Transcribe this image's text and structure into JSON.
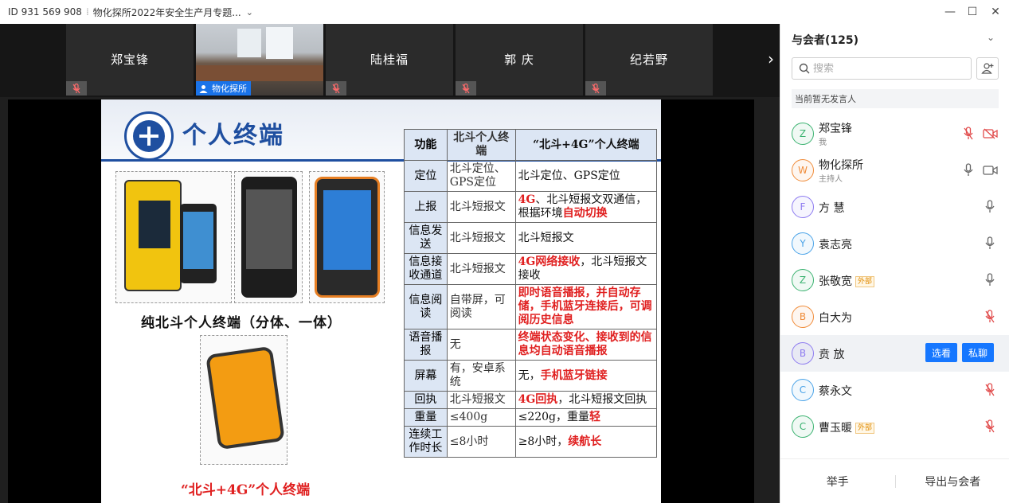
{
  "titlebar": {
    "meeting_id": "ID 931 569 908",
    "separator": "⁞",
    "meeting_title": "物化探所2022年安全生产月专题...",
    "dropdown": "⌄",
    "minimize": "—",
    "maximize": "☐",
    "close": "✕"
  },
  "strip": {
    "tiles": [
      {
        "name": "郑宝锋"
      },
      {
        "name": "物化探所"
      },
      {
        "name": "陆桂福"
      },
      {
        "name": "郭  庆"
      },
      {
        "name": "纪若野"
      }
    ],
    "next": "›"
  },
  "slide": {
    "title": "个人终端",
    "caption1": "纯北斗个人终端（分体、一体）",
    "caption2": "“北斗+4G”个人终端",
    "table": {
      "header": [
        "功能",
        "北斗个人终端",
        "“北斗+4G”个人终端"
      ],
      "rows": [
        {
          "f": "定位",
          "b": "北斗定位、GPS定位",
          "c": [
            {
              "t": "北斗定位、GPS定位"
            }
          ]
        },
        {
          "f": "上报",
          "b": "北斗短报文",
          "c": [
            {
              "t": "4G",
              "red": true
            },
            {
              "t": "、北斗短报文双通信，根据环境"
            },
            {
              "t": "自动切换",
              "red": true
            }
          ]
        },
        {
          "f": "信息发送",
          "b": "北斗短报文",
          "c": [
            {
              "t": "北斗短报文"
            }
          ]
        },
        {
          "f": "信息接收通道",
          "b": "北斗短报文",
          "c": [
            {
              "t": "4G网络接收",
              "red": true
            },
            {
              "t": "，北斗短报文接收"
            }
          ]
        },
        {
          "f": "信息阅读",
          "b": "自带屏，可阅读",
          "c": [
            {
              "t": "即时语音播报，并自动存储，手机蓝牙连接后，可调阅历史信息",
              "red": true
            }
          ]
        },
        {
          "f": "语音播报",
          "b": "无",
          "c": [
            {
              "t": "终端状态变化、接收到的信息均自动语音播报",
              "red": true
            }
          ]
        },
        {
          "f": "屏幕",
          "b": "有，安卓系统",
          "c": [
            {
              "t": "无，"
            },
            {
              "t": "手机蓝牙链接",
              "red": true
            }
          ]
        },
        {
          "f": "回执",
          "b": "北斗短报文",
          "c": [
            {
              "t": "4G回执",
              "red": true
            },
            {
              "t": "，北斗短报文回执"
            }
          ]
        },
        {
          "f": "重量",
          "b": "≤400g",
          "c": [
            {
              "t": "≤220g，重量"
            },
            {
              "t": "轻",
              "red": true
            }
          ]
        },
        {
          "f": "连续工作时长",
          "b": "≤8小时",
          "c": [
            {
              "t": "≥8小时，"
            },
            {
              "t": "续航长",
              "red": true
            }
          ]
        }
      ]
    }
  },
  "panel": {
    "title": "与会者(125)",
    "collapse": "⌄",
    "search_placeholder": "搜索",
    "speaker_status": "当前暂无发言人",
    "participants": [
      {
        "initial": "Z",
        "name": "郑宝锋",
        "role": "我",
        "ext": "",
        "color": "#3cb371",
        "mic": "muted",
        "cam": "off"
      },
      {
        "initial": "W",
        "name": "物化探所",
        "role": "主持人",
        "ext": "",
        "color": "#f08c3a",
        "mic": "on",
        "cam": "on"
      },
      {
        "initial": "F",
        "name": "方  慧",
        "role": "",
        "ext": "",
        "color": "#8e7cf0",
        "mic": "on",
        "cam": ""
      },
      {
        "initial": "Y",
        "name": "袁志亮",
        "role": "",
        "ext": "",
        "color": "#4aa3e8",
        "mic": "on",
        "cam": ""
      },
      {
        "initial": "Z",
        "name": "张敬宽",
        "role": "",
        "ext": "外部",
        "color": "#3cb371",
        "mic": "on",
        "cam": ""
      },
      {
        "initial": "B",
        "name": "白大为",
        "role": "",
        "ext": "",
        "color": "#f08c3a",
        "mic": "muted",
        "cam": ""
      },
      {
        "initial": "B",
        "name": "贲  放",
        "role": "",
        "ext": "",
        "color": "#8e7cf0",
        "mic": "",
        "cam": "",
        "hover": true
      },
      {
        "initial": "C",
        "name": "蔡永文",
        "role": "",
        "ext": "",
        "color": "#4aa3e8",
        "mic": "muted",
        "cam": ""
      },
      {
        "initial": "C",
        "name": "曹玉暖",
        "role": "",
        "ext": "外部",
        "color": "#3cb371",
        "mic": "muted",
        "cam": ""
      }
    ],
    "hover_actions": {
      "watch": "选看",
      "chat": "私聊"
    },
    "footer": {
      "raise_hand": "举手",
      "export": "导出与会者"
    }
  }
}
